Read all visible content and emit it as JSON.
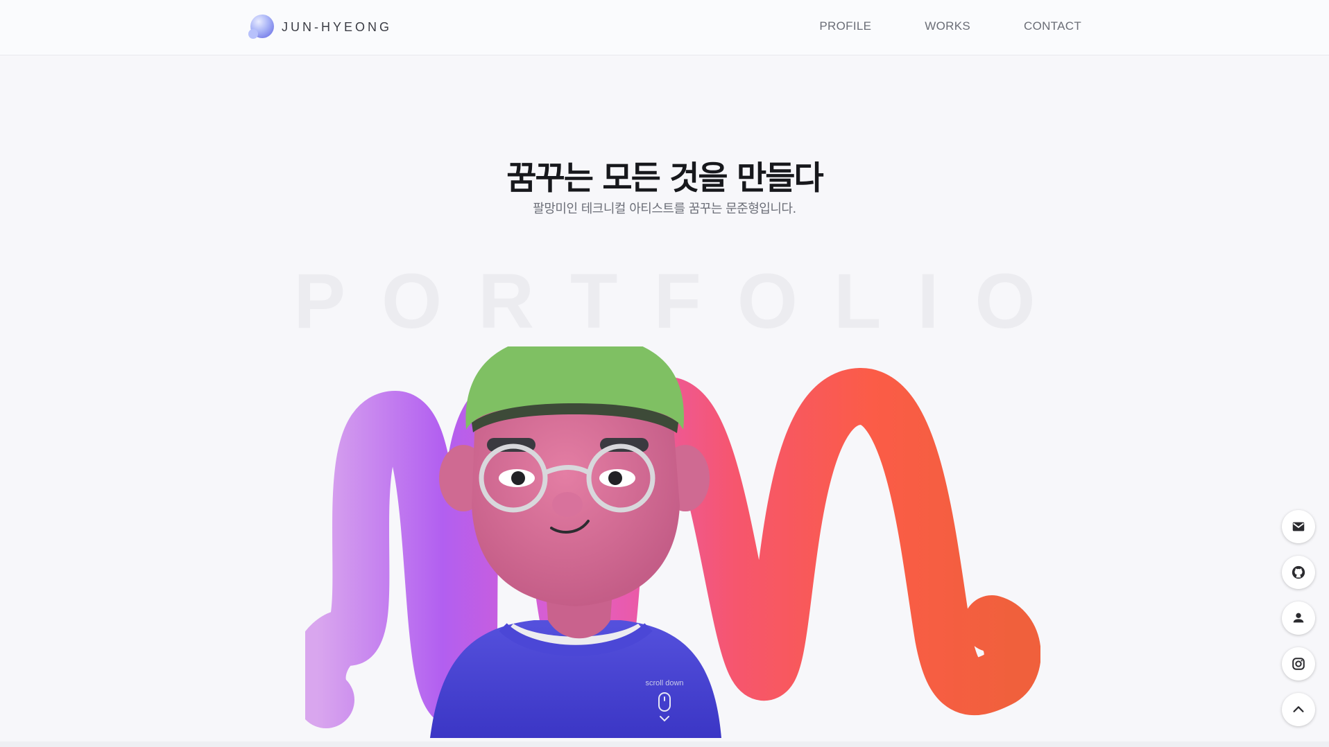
{
  "header": {
    "logo_text": "JUN-HYEONG",
    "nav": [
      "PROFILE",
      "WORKS",
      "CONTACT"
    ]
  },
  "hero": {
    "title": "꿈꾸는 모든 것을 만들다",
    "subtitle": "팔망미인 테크니컬 아티스트를 꿈꾸는 문준형입니다.",
    "background_word": "PORTFOLIO",
    "scroll_label": "scroll down"
  },
  "side_buttons": [
    "mail-icon",
    "github-icon",
    "person-icon",
    "instagram-icon",
    "chevron-up-icon"
  ],
  "colors": {
    "accent": "#4d4ad6",
    "hat": "#7fc063",
    "face": "#d46a93",
    "sweater": "#4a45d0"
  }
}
